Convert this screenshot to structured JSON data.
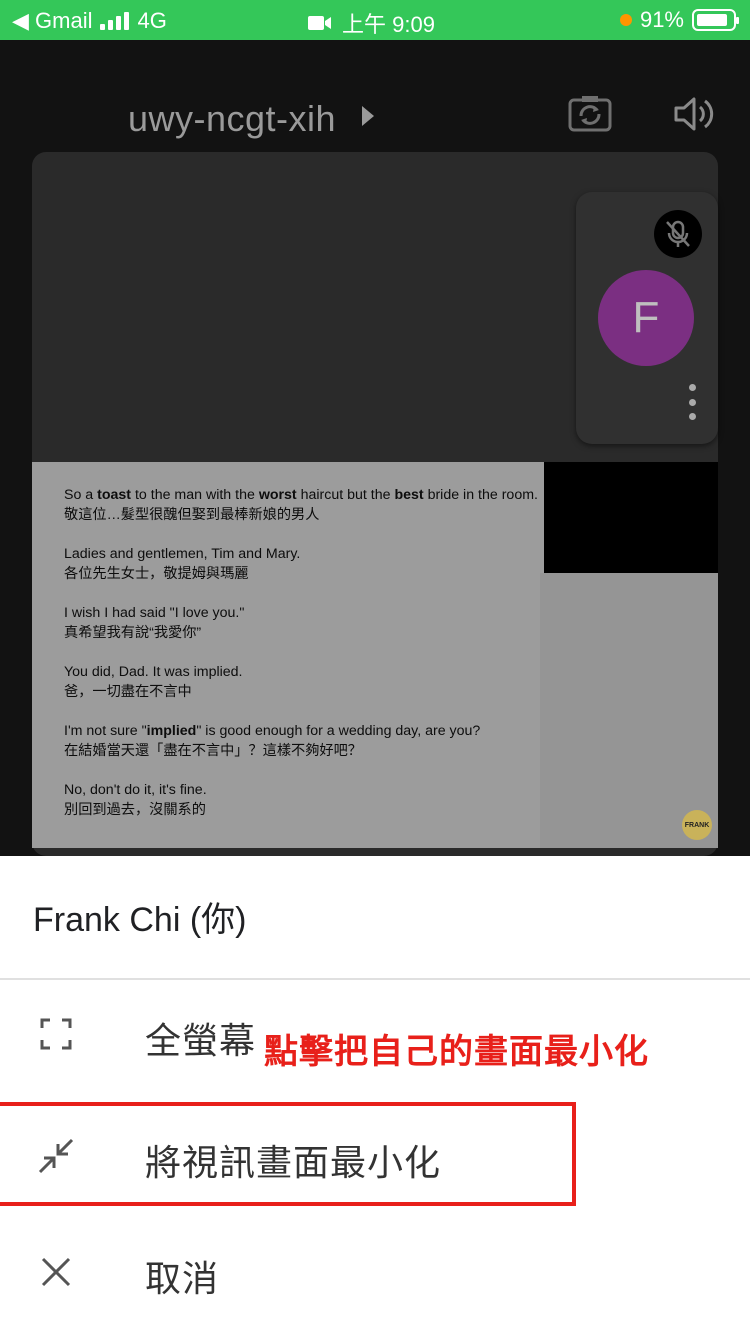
{
  "status_bar": {
    "carrier": "◀ Gmail",
    "network": "4G",
    "time": "上午 9:09",
    "battery": "91%",
    "colors": {
      "background": "#34c759",
      "dot": "#ff9500"
    }
  },
  "meeting": {
    "code": "uwy-ncgt-xih",
    "self_tile": {
      "avatar_initial": "F",
      "avatar_color": "#7b2f82"
    },
    "subtitles": [
      {
        "en_parts": [
          "So a ",
          "toast",
          " to the man with the ",
          "worst",
          " haircut but the ",
          "best",
          " bride in the room."
        ],
        "zh": "敬這位…髮型很醜但娶到最棒新娘的男人"
      },
      {
        "en": "Ladies and gentlemen, Tim and Mary.",
        "zh": "各位先生女士，敬提姆與瑪麗"
      },
      {
        "en": "I wish I had said \"I love you.\"",
        "zh": "真希望我有說“我愛你”"
      },
      {
        "en": "You did, Dad. It was implied.",
        "zh": "爸，一切盡在不言中"
      },
      {
        "en_parts": [
          "I'm not sure \"",
          "implied",
          "\" is good enough for a wedding day, are you?"
        ],
        "zh": "在結婚當天還「盡在不言中」？這樣不夠好吧？"
      },
      {
        "en": "No, don't do it, it's fine.",
        "zh": "別回到過去，沒關系的"
      }
    ],
    "logo_text": "FRANK"
  },
  "sheet": {
    "title": "Frank Chi (你)",
    "items": [
      {
        "label": "全螢幕",
        "icon": "fullscreen-icon"
      },
      {
        "label": "將視訊畫面最小化",
        "icon": "minimize-icon"
      },
      {
        "label": "取消",
        "icon": "close-icon"
      }
    ],
    "annotation": "點擊把自己的畫面最小化",
    "annotation_color": "#e8201a"
  }
}
